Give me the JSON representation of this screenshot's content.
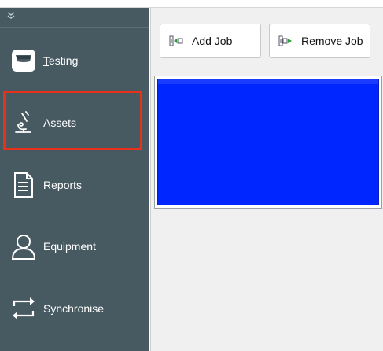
{
  "sidebar": {
    "items": [
      {
        "label_underline": "T",
        "label_rest": "esting",
        "icon": "testing-icon"
      },
      {
        "label": "Assets",
        "icon": "microscope-icon"
      },
      {
        "label_underline": "R",
        "label_rest": "eports",
        "icon": "document-icon"
      },
      {
        "label": "Equipment",
        "icon": "person-icon"
      },
      {
        "label": "Synchronise",
        "icon": "sync-icon"
      }
    ],
    "collapse_icon": "double-chevron-down-icon"
  },
  "toolbar": {
    "add_label": "Add Job",
    "remove_label": "Remove Job"
  },
  "colors": {
    "sidebar_bg": "#475a62",
    "selection_outline": "#e8311c",
    "grid_fill": "#0026ff"
  }
}
